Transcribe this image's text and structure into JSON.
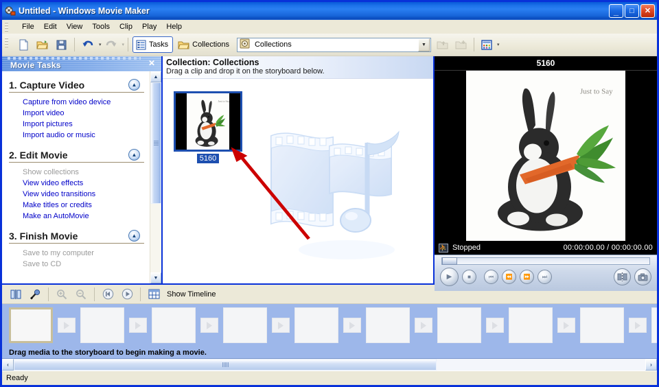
{
  "window": {
    "title": "Untitled - Windows Movie Maker",
    "icon": "movie-maker-icon",
    "minimize": "_",
    "maximize": "□",
    "close": "✕"
  },
  "menu": {
    "items": [
      "File",
      "Edit",
      "View",
      "Tools",
      "Clip",
      "Play",
      "Help"
    ]
  },
  "toolbar": {
    "new_label": "new-project-icon",
    "open_label": "open-project-icon",
    "save_label": "save-project-icon",
    "undo_label": "undo-icon",
    "redo_label": "redo-icon",
    "tasks_label": "Tasks",
    "collections_label": "Collections",
    "combo_value": "Collections",
    "combo_icon": "collection-icon",
    "dropdown_arrow": "▾",
    "up_folder": "up-one-level-icon",
    "new_collection": "new-collection-icon",
    "views_label": "views-icon"
  },
  "task_pane": {
    "header": "Movie Tasks",
    "close": "✕",
    "sections": [
      {
        "title": "1. Capture Video",
        "collapse": "▲",
        "links": [
          {
            "label": "Capture from video device",
            "disabled": false
          },
          {
            "label": "Import video",
            "disabled": false
          },
          {
            "label": "Import pictures",
            "disabled": false
          },
          {
            "label": "Import audio or music",
            "disabled": false
          }
        ]
      },
      {
        "title": "2. Edit Movie",
        "collapse": "▲",
        "links": [
          {
            "label": "Show collections",
            "disabled": true
          },
          {
            "label": "View video effects",
            "disabled": false
          },
          {
            "label": "View video transitions",
            "disabled": false
          },
          {
            "label": "Make titles or credits",
            "disabled": false
          },
          {
            "label": "Make an AutoMovie",
            "disabled": false
          }
        ]
      },
      {
        "title": "3. Finish Movie",
        "collapse": "▲",
        "links": [
          {
            "label": "Save to my computer",
            "disabled": true
          },
          {
            "label": "Save to CD",
            "disabled": true
          }
        ]
      }
    ],
    "scroll_up": "▲",
    "scroll_down": "▼"
  },
  "collections": {
    "title": "Collection: Collections",
    "subtitle": "Drag a clip and drop it on the storyboard below.",
    "clip": {
      "name": "5160",
      "caption_text": "Just to Say"
    }
  },
  "monitor": {
    "title": "5160",
    "status": "Stopped",
    "time": "00:00:00.00 / 00:00:00.00",
    "fullscreen_icon": "fullscreen-icon",
    "controls": {
      "play": "▶",
      "stop": "■",
      "previous": "⏮",
      "back_frame": "⏪",
      "next_frame": "⏩",
      "next": "⏭",
      "split": "split-clip-icon",
      "take_picture": "take-picture-icon"
    }
  },
  "storyboard": {
    "toolbar": {
      "split": "split-icon",
      "narrate": "narrate-timeline-icon",
      "zoom_in": "zoom-in-icon",
      "zoom_out": "zoom-out-icon",
      "rewind": "rewind-storyboard-icon",
      "play": "play-storyboard-icon",
      "view_icon": "show-timeline-icon",
      "view_label": "Show Timeline"
    },
    "hint": "Drag media to the storyboard to begin making a movie.",
    "cells": [
      {
        "selected": true
      },
      {
        "selected": false
      },
      {
        "selected": false
      },
      {
        "selected": false
      },
      {
        "selected": false
      },
      {
        "selected": false
      },
      {
        "selected": false
      },
      {
        "selected": false
      },
      {
        "selected": false
      },
      {
        "selected": false
      },
      {
        "selected": false
      }
    ],
    "scroll_left": "‹",
    "scroll_right": "›"
  },
  "status_bar": {
    "text": "Ready"
  },
  "colors": {
    "title_blue": "#0831d9",
    "selection_blue": "#1d4fb0",
    "storyboard_blue": "#9db7ea",
    "link_blue": "#0000c8",
    "annotation_red": "#cc0000"
  }
}
